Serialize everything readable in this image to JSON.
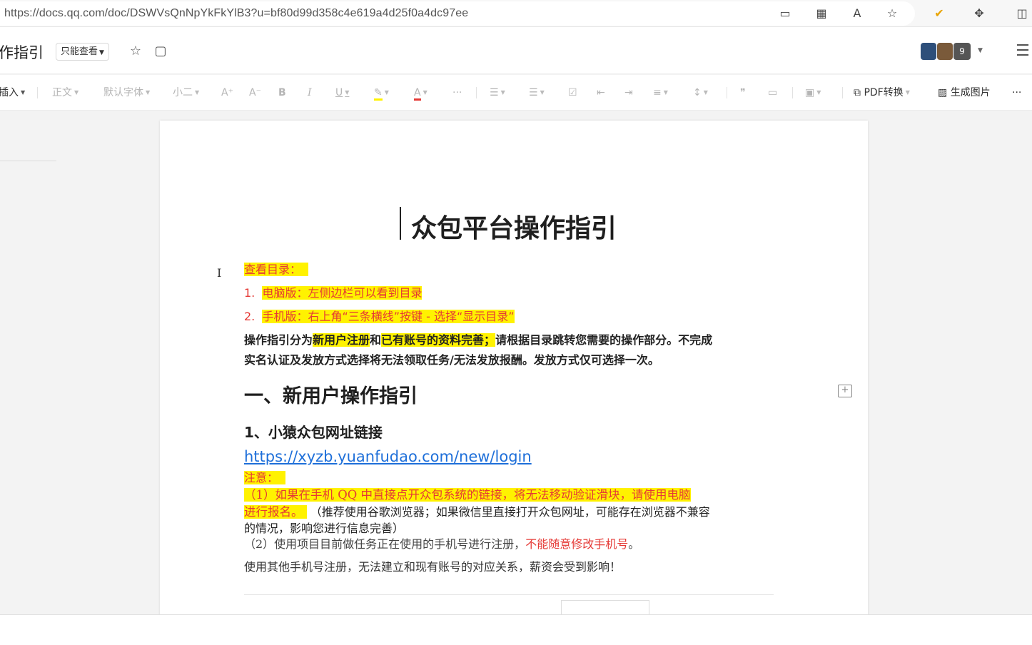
{
  "browser": {
    "url": "https://docs.qq.com/doc/DSWVsQnNpYkFkYlB3?u=bf80d99d358c4e619a4d25f0a4dc97ee"
  },
  "header": {
    "title": "作指引",
    "mode_label": "只能查看",
    "collaborator_count": "9"
  },
  "toolbar": {
    "insert": "插入",
    "style": "正文",
    "font": "默认字体",
    "size": "小二",
    "pdf": "PDF转换",
    "gen_image": "生成图片",
    "more": "···"
  },
  "doc": {
    "title": "众包平台操作指引",
    "toc_label": "查看目录：",
    "toc_item1_num": "1.",
    "toc_item1": "电脑版：左侧边栏可以看到目录",
    "toc_item2_num": "2.",
    "toc_item2": "手机版：右上角“三条横线”按键 - 选择“显示目录”",
    "intro_a": "操作指引分为",
    "intro_b": "新用户注册",
    "intro_c": "和",
    "intro_d": "已有账号的资料完善；",
    "intro_e": "请根据目录跳转您需要的操作部分。不完成",
    "intro_line2": "实名认证及发放方式选择将无法领取任务/无法发放报酬。发放方式仅可选择一次。",
    "section1": "一、新用户操作指引",
    "sub1": "1、小猿众包网址链接",
    "link": "https://xyzb.yuanfudao.com/new/login",
    "note_label": "注意：",
    "note1_a": "（1）如果在",
    "note1_b": "手机 QQ 中直接点开众包系统的链接，将无法移动验证滑块，请使用电脑",
    "note1_c": "进行报名。",
    "note1_d": "（推荐使用谷歌浏览器；如果微信里直接打开众包网址，可能存在浏览器不兼容",
    "note1_e": "的情况，影响您进行信息完善）",
    "note2_a": "（2）使用项目目前做任务正在使用的手机号进行注册，",
    "note2_b": "不能随意修改手机号",
    "note2_c": "。",
    "warning": "使用其他手机号注册，无法建立和现有账号的对应关系，薪资会受到影响！"
  }
}
